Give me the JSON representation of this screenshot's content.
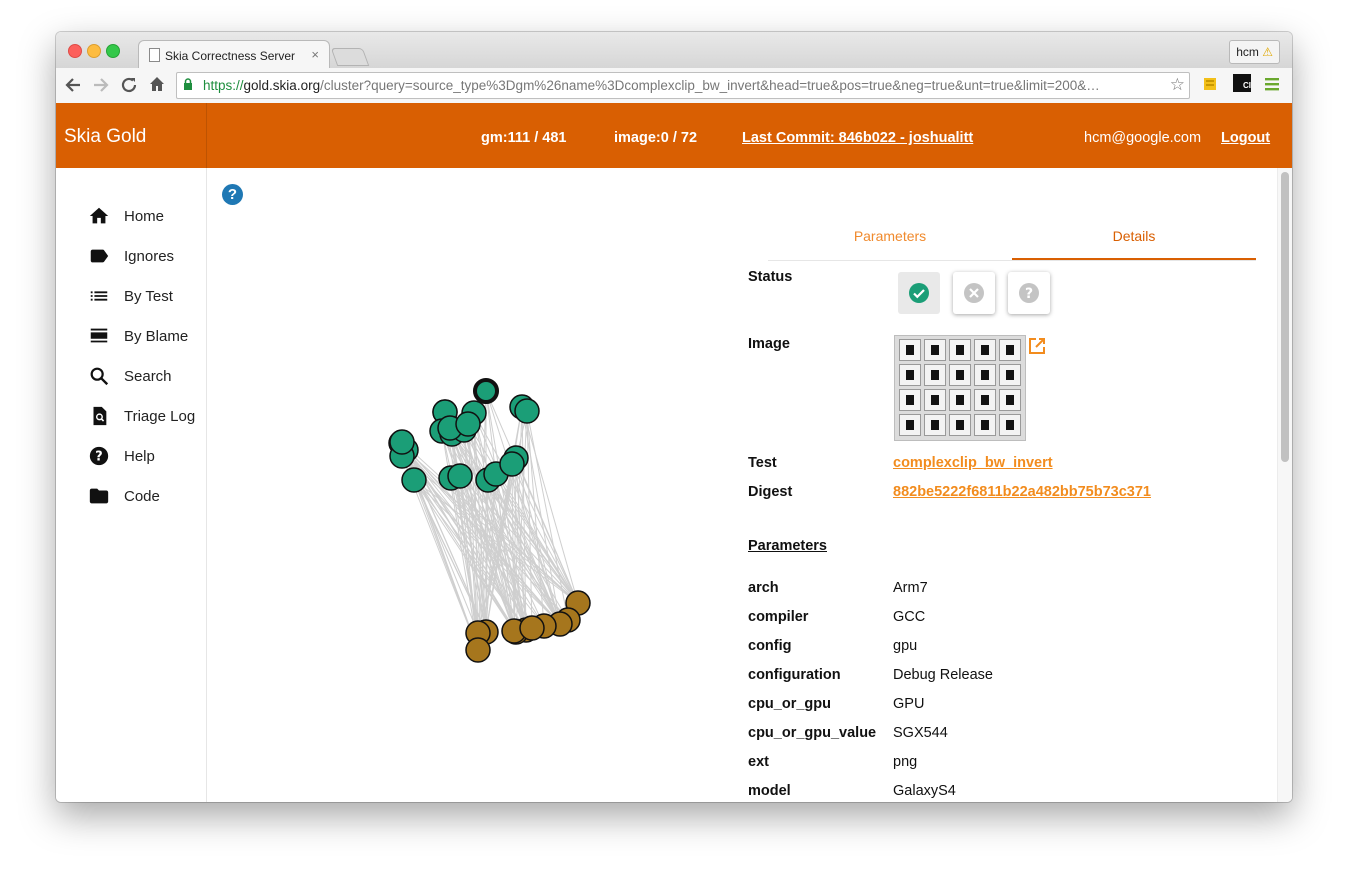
{
  "browser": {
    "tab_title": "Skia Correctness Server",
    "tab_close": "×",
    "profile_name": "hcm",
    "profile_warning": "⚠",
    "url_scheme": "https://",
    "url_host": "gold.skia.org",
    "url_path": "/cluster?query=source_type%3Dgm%26name%3Dcomplexclip_bw_invert&head=true&pos=true&neg=true&unt=true&limit=200&…",
    "ext_label": "CI"
  },
  "header": {
    "brand": "Skia Gold",
    "gm_status": "gm:111 / 481",
    "image_status": "image:0 / 72",
    "last_commit": "Last Commit: 846b022 - joshualitt",
    "user": "hcm@google.com",
    "logout": "Logout"
  },
  "sidebar": {
    "items": [
      {
        "label": "Home",
        "icon": "home-icon"
      },
      {
        "label": "Ignores",
        "icon": "label-icon"
      },
      {
        "label": "By Test",
        "icon": "list-icon"
      },
      {
        "label": "By Blame",
        "icon": "blame-icon"
      },
      {
        "label": "Search",
        "icon": "search-icon"
      },
      {
        "label": "Triage Log",
        "icon": "triage-log-icon"
      },
      {
        "label": "Help",
        "icon": "help-icon"
      },
      {
        "label": "Code",
        "icon": "folder-icon"
      }
    ]
  },
  "help_button": "?",
  "colors": {
    "brand": "#d95f02",
    "positive": "#1b9e77",
    "negative": "#e7298a",
    "untriaged": "#a6761d",
    "link": "#f28c1e"
  },
  "details": {
    "tabs": [
      {
        "label": "Parameters",
        "active": false
      },
      {
        "label": "Details",
        "active": true
      }
    ],
    "status_label": "Status",
    "image_label": "Image",
    "test_label": "Test",
    "test_value": "complexclip_bw_invert",
    "digest_label": "Digest",
    "digest_value": "882be5222f6811b22a482bb75b73c371",
    "params_heading": "Parameters",
    "params": [
      {
        "key": "arch",
        "value": "Arm7"
      },
      {
        "key": "compiler",
        "value": "GCC"
      },
      {
        "key": "config",
        "value": "gpu"
      },
      {
        "key": "configuration",
        "value": "Debug Release"
      },
      {
        "key": "cpu_or_gpu",
        "value": "GPU"
      },
      {
        "key": "cpu_or_gpu_value",
        "value": "SGX544"
      },
      {
        "key": "ext",
        "value": "png"
      },
      {
        "key": "model",
        "value": "GalaxyS4"
      }
    ]
  }
}
